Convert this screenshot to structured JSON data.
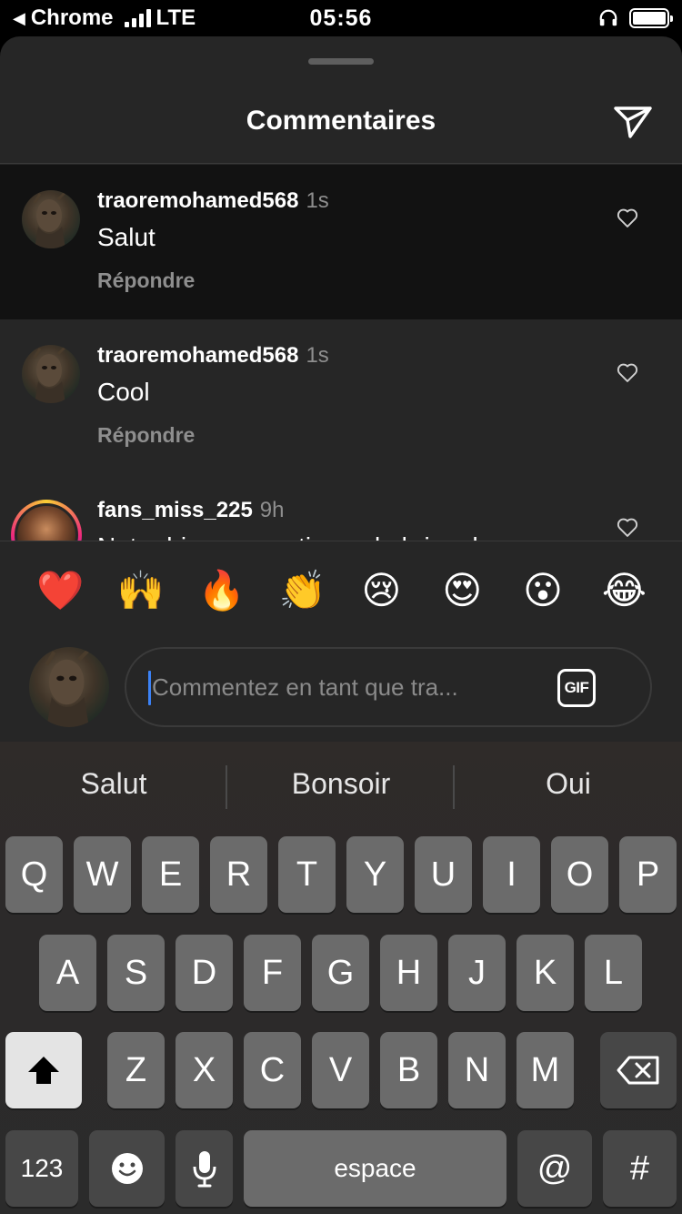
{
  "status_bar": {
    "back_app": "Chrome",
    "network": "LTE",
    "time": "05:56"
  },
  "sheet": {
    "title": "Commentaires"
  },
  "comments": [
    {
      "username": "traoremohamed568",
      "time": "1s",
      "text": "Salut",
      "reply_label": "Répondre"
    },
    {
      "username": "traoremohamed568",
      "time": "1s",
      "text": "Cool",
      "reply_label": "Répondre"
    },
    {
      "username": "fans_miss_225",
      "time": "9h",
      "text": "Notre bien connu tip sur la brise de..."
    }
  ],
  "emoji_reactions": [
    "❤️",
    "🙌",
    "🔥",
    "👏",
    "😢",
    "😍",
    "😮",
    "😂"
  ],
  "composer": {
    "placeholder": "Commentez en tant que tra...",
    "gif_label": "GIF"
  },
  "keyboard": {
    "suggestions": [
      "Salut",
      "Bonsoir",
      "Oui"
    ],
    "row1": [
      "Q",
      "W",
      "E",
      "R",
      "T",
      "Y",
      "U",
      "I",
      "O",
      "P"
    ],
    "row2": [
      "A",
      "S",
      "D",
      "F",
      "G",
      "H",
      "J",
      "K",
      "L"
    ],
    "row3": [
      "Z",
      "X",
      "C",
      "V",
      "B",
      "N",
      "M"
    ],
    "numbers_label": "123",
    "space_label": "espace",
    "at_label": "@",
    "hash_label": "#"
  }
}
